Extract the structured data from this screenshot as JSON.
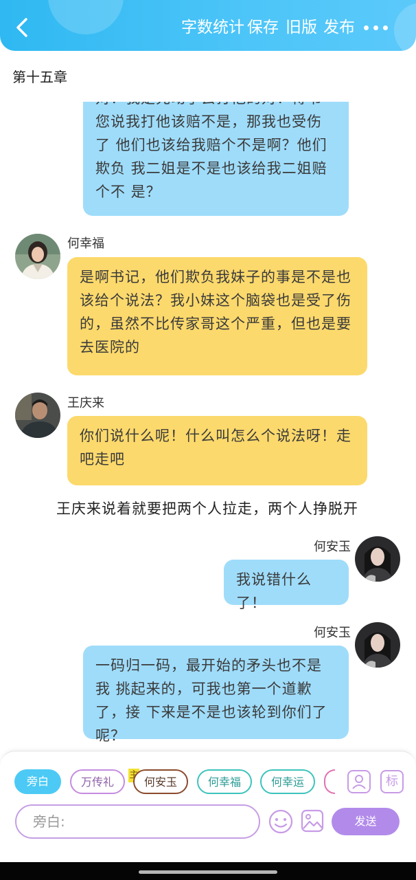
{
  "header": {
    "buttons": [
      "字数统计",
      "保存",
      "旧版",
      "发布"
    ]
  },
  "chapter": {
    "title": "第十五章"
  },
  "messages": [
    {
      "text": "对！我是先动手去打他的对！得书 您说我打他该赔不是，那我也受伤了 他们也该给我赔个不是啊？他们欺负 我二姐是不是也该给我二姐赔个不 是？"
    },
    {
      "speaker": "何幸福",
      "text": "是啊书记，他们欺负我妹子的事是不是也 该给个说法？我小妹这个脑袋也是受了伤 的，虽然不比传家哥这个严重，但也是要 去医院的"
    },
    {
      "speaker": "王庆来",
      "text": "你们说什么呢！什么叫怎么个说法呀！走 吧走吧"
    },
    {
      "narration": "王庆来说着就要把两个人拉走，两个人挣脱开"
    },
    {
      "speaker": "何安玉",
      "text": "我说错什么了！"
    },
    {
      "speaker": "何安玉",
      "text": "一码归一码，最开始的矛头也不是我 挑起来的，可我也第一个道歉了，接 下来是不是也该轮到你们了呢？"
    }
  ],
  "roles": [
    "旁白",
    "万传礼",
    "何安玉",
    "何幸福",
    "何幸运"
  ],
  "main_badge": "主",
  "input": {
    "placeholder": "旁白:"
  },
  "send_label": "发送",
  "tag_label": "标",
  "colors": {
    "header": "#3dbff5",
    "blue_bubble": "#9fdcfa",
    "yellow_bubble": "#fcd96c",
    "send": "#b28bea",
    "accent": "#4ccaf5"
  },
  "icons": [
    "back-arrow-icon",
    "more-icon",
    "person-icon",
    "emoji-icon",
    "image-icon"
  ]
}
